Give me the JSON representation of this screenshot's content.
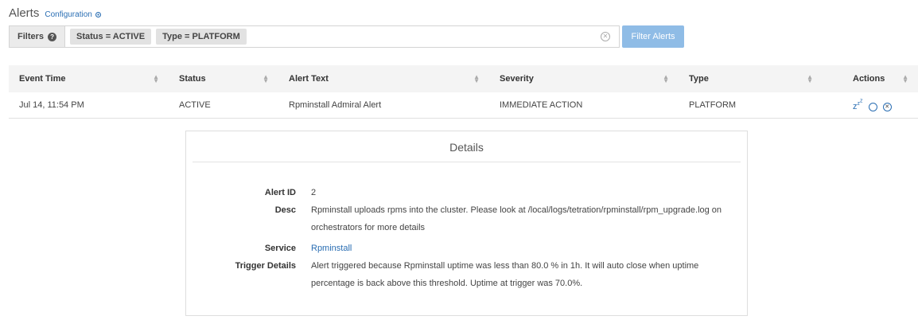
{
  "header": {
    "title": "Alerts",
    "config_link": "Configuration"
  },
  "filters": {
    "label": "Filters",
    "chips": [
      "Status = ACTIVE",
      "Type = PLATFORM"
    ],
    "button": "Filter Alerts"
  },
  "table": {
    "columns": [
      "Event Time",
      "Status",
      "Alert Text",
      "Severity",
      "Type",
      "Actions"
    ],
    "rows": [
      [
        "Jul 14, 11:54 PM",
        "ACTIVE",
        "Rpminstall Admiral Alert",
        "IMMEDIATE ACTION",
        "PLATFORM"
      ]
    ]
  },
  "details": {
    "title": "Details",
    "alert_id_label": "Alert ID",
    "alert_id": "2",
    "desc_label": "Desc",
    "desc": "Rpminstall uploads rpms into the cluster. Please look at /local/logs/tetration/rpminstall/rpm_upgrade.log on orchestrators for more details",
    "service_label": "Service",
    "service": "Rpminstall",
    "trigger_label": "Trigger Details",
    "trigger": "Alert triggered because Rpminstall uptime was less than 80.0 % in 1h. It will auto close when uptime percentage is back above this threshold. Uptime at trigger was 70.0%."
  },
  "icons": {
    "config": "gear-icon",
    "help": "help-icon",
    "clear": "clear-icon",
    "snooze": "snooze-icon",
    "acknowledge": "acknowledge-icon",
    "close": "close-icon",
    "sort": "sort-icon"
  },
  "colors": {
    "accent": "#2a6eb3",
    "button": "#8fbce6",
    "header_bg": "#f4f4f4"
  }
}
